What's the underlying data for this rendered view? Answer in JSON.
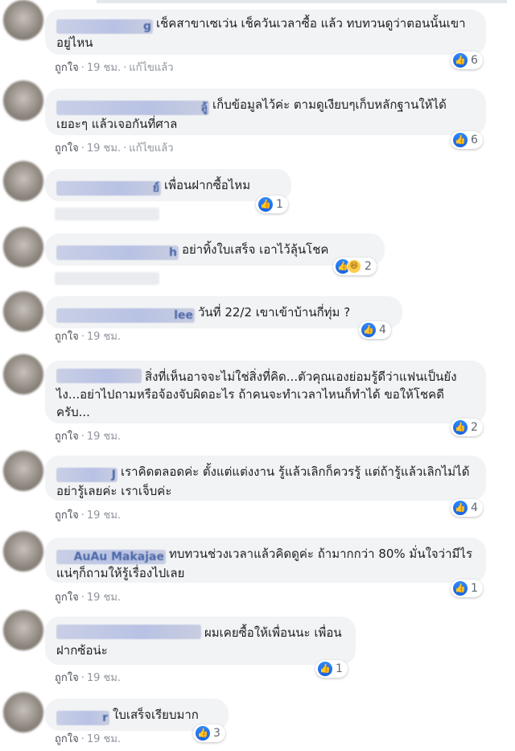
{
  "actions": {
    "like": "ถูกใจ",
    "time": "19 ชม.",
    "edited": "แก้ไขแล้ว",
    "separator": "·"
  },
  "comments": [
    {
      "name": "g",
      "text": "เช็คสาขาเซเว่น เช็ควันเวลาซื้อ แล้ว ทบทวนดูว่าตอนนั้นเขาอยู่ไหน",
      "reaction_count": "6",
      "edited": true
    },
    {
      "name": "ลู้",
      "text": "เก็บข้อมูลไว้ค่ะ ตามดูเงียบๆเก็บหลักฐานให้ได้เยอะๆ แล้วเจอกันที่ศาล",
      "reaction_count": "6",
      "edited": true
    },
    {
      "name": "ย์",
      "text": "เพื่อนฝากซื้อไหม",
      "reaction_count": "1"
    },
    {
      "name": "h",
      "text": "อย่าทิ้งใบเสร็จ เอาไว้ลุ้นโชค",
      "reaction_count": "2"
    },
    {
      "name": "lee",
      "text": "วันที่ 22/2 เขาเข้าบ้านกี่ทุ่ม ?",
      "reaction_count": "4"
    },
    {
      "name": "",
      "text": "สิ่งที่เห็นอาจจะไม่ใช่สิ่งที่คิด...ตัวคุณเองย่อมรู้ดีว่าแฟนเป็นยังไง...อย่าไปถามหรือจ้องจับผิดอะไร ถ้าคนจะทำเวลาไหนก็ทำได้ ขอให้โชคดีครับ...",
      "reaction_count": "2"
    },
    {
      "name": "J",
      "text": "เราคิดตลอดค่ะ ตั้งแต่แต่งงาน รู้แล้วเลิกก็ควรรู้ แต่ถ้ารู้แล้วเลิกไม่ได้ อย่ารู้เลยค่ะ เราเจ็บค่ะ",
      "reaction_count": "4"
    },
    {
      "name": "AuAu Makajae",
      "text": "ทบทวนช่วงเวลาแล้วคิดดูค่ะ ถ้ามากกว่า 80% มั่นใจว่ามีไรแน่ๆก็ถามให้รู้เรื่องไปเลย",
      "reaction_count": "1"
    },
    {
      "name": "",
      "text": "ผมเคยซื้อให้เพื่อนนะ เพื่อนฝากซ้อน่ะ",
      "reaction_count": "1"
    },
    {
      "name": "r",
      "text": "ใบเสร็จเรียบมาก",
      "reaction_count": "3"
    }
  ]
}
